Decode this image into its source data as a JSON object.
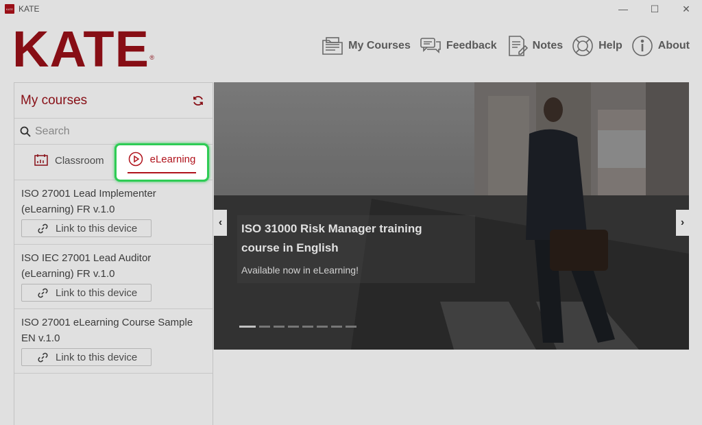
{
  "window": {
    "title": "KATE",
    "app_icon_text": "KATE",
    "controls": {
      "minimize": "—",
      "maximize": "☐",
      "close": "✕"
    }
  },
  "header": {
    "logo": "KATE",
    "logo_mark": "®",
    "nav": [
      {
        "label": "My Courses",
        "icon": "folder-icon"
      },
      {
        "label": "Feedback",
        "icon": "chat-icon"
      },
      {
        "label": "Notes",
        "icon": "notes-icon"
      },
      {
        "label": "Help",
        "icon": "lifebuoy-icon"
      },
      {
        "label": "About",
        "icon": "info-icon"
      }
    ]
  },
  "sidebar": {
    "title": "My courses",
    "search_placeholder": "Search",
    "tabs": {
      "classroom": "Classroom",
      "elearning": "eLearning"
    },
    "courses": [
      {
        "title": "ISO 27001 Lead Implementer (eLearning) FR v.1.0",
        "link_label": "Link to this device"
      },
      {
        "title": "ISO IEC 27001 Lead Auditor (eLearning) FR v.1.0",
        "link_label": "Link to this device"
      },
      {
        "title": "ISO 27001 eLearning Course Sample EN v.1.0",
        "link_label": "Link to this device"
      }
    ]
  },
  "banner": {
    "title": "ISO 31000 Risk Manager training course in English",
    "subtitle": "Available now in eLearning!",
    "prev": "‹",
    "next": "›",
    "slide_count": 8,
    "active_slide": 1
  },
  "colors": {
    "brand": "#9a1119",
    "highlight": "#2ecc55"
  }
}
